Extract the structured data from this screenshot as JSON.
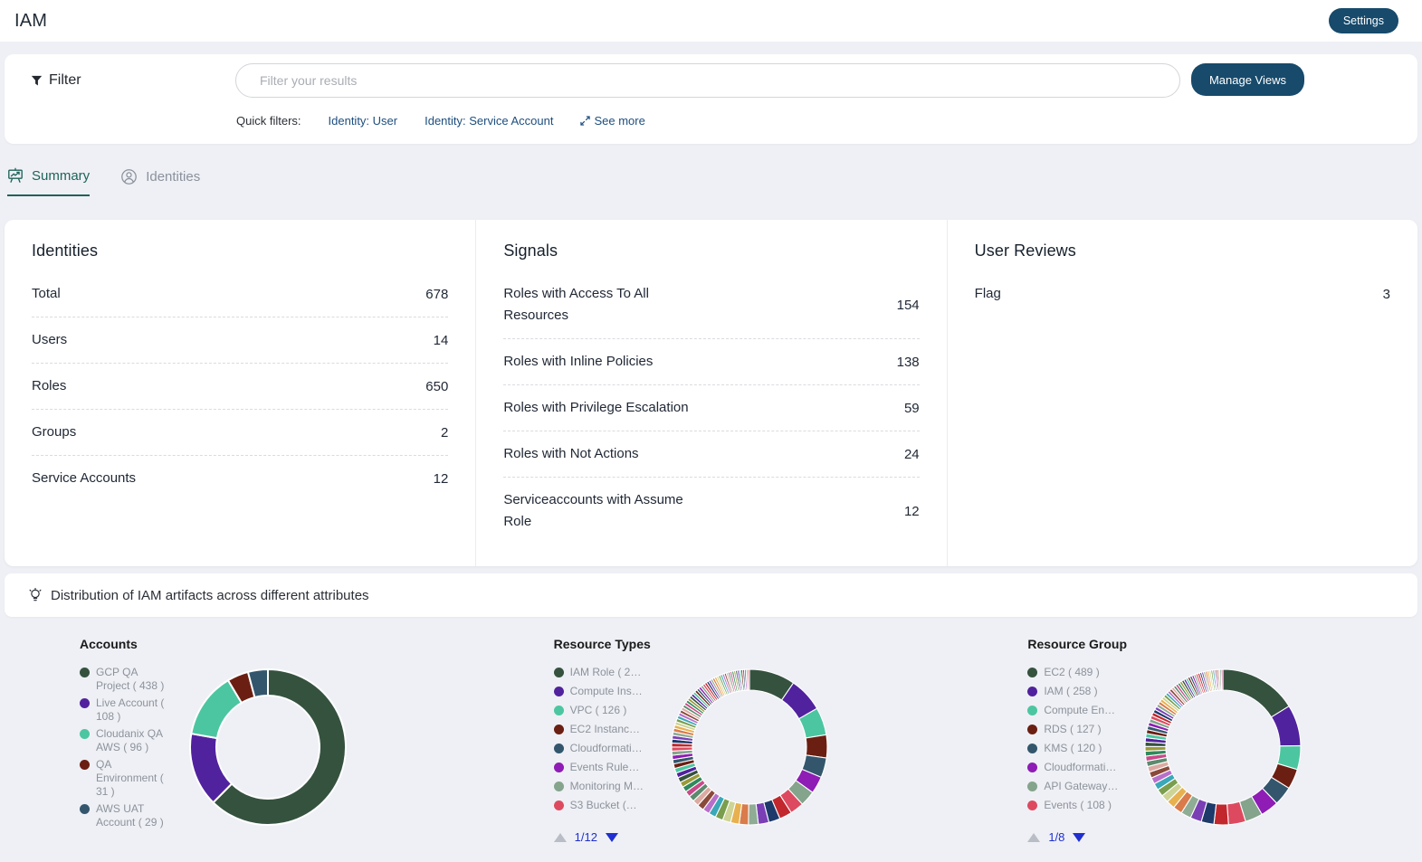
{
  "topbar": {
    "title": "IAM",
    "settings_label": "Settings"
  },
  "filter": {
    "label": "Filter",
    "input_value": "",
    "input_placeholder": "Filter your results",
    "manage_views_label": "Manage Views",
    "quick": {
      "label": "Quick filters:",
      "links": [
        "Identity: User",
        "Identity: Service Account"
      ],
      "see_more": "See more"
    }
  },
  "tabs": [
    {
      "label": "Summary",
      "active": true,
      "icon": "presentation-chart-icon"
    },
    {
      "label": "Identities",
      "active": false,
      "icon": "person-circle-icon"
    }
  ],
  "cards": [
    {
      "title": "Identities",
      "rows": [
        {
          "label": "Total",
          "value": "678"
        },
        {
          "label": "Users",
          "value": "14"
        },
        {
          "label": "Roles",
          "value": "650"
        },
        {
          "label": "Groups",
          "value": "2"
        },
        {
          "label": "Service Accounts",
          "value": "12"
        }
      ]
    },
    {
      "title": "Signals",
      "rows": [
        {
          "label": "Roles with Access To All Resources",
          "value": "154"
        },
        {
          "label": "Roles with Inline Policies",
          "value": "138"
        },
        {
          "label": "Roles with Privilege Escalation",
          "value": "59"
        },
        {
          "label": "Roles with Not Actions",
          "value": "24"
        },
        {
          "label": "Serviceaccounts with Assume Role",
          "value": "12"
        }
      ]
    },
    {
      "title": "User Reviews",
      "rows": [
        {
          "label": "Flag",
          "value": "3"
        }
      ]
    }
  ],
  "distribution": {
    "header": "Distribution of IAM artifacts across different attributes"
  },
  "colors": {
    "accent_navy": "#174a6b",
    "link_blue": "#1d4e7e",
    "tab_active": "#1e635a",
    "pager_blue": "#1f2fd0",
    "page_bg": "#eef0f5"
  },
  "chart_data": [
    {
      "type": "donut",
      "title": "Accounts",
      "legend": [
        {
          "label": "GCP QA Project ( 438 )",
          "color": "#35523f"
        },
        {
          "label": "Live Account ( 108 )",
          "color": "#51229e"
        },
        {
          "label": "Cloudanix QA AWS ( 96 )",
          "color": "#4cc6a0"
        },
        {
          "label": "QA Environment ( 31 )",
          "color": "#6b1f12"
        },
        {
          "label": "AWS UAT Account ( 29 )",
          "color": "#33566d"
        }
      ],
      "values": [
        438,
        108,
        96,
        31,
        29
      ],
      "palette": [
        "#35523f",
        "#51229e",
        "#4cc6a0",
        "#6b1f12",
        "#33566d"
      ],
      "outer_radius": 86,
      "inner_radius": 57,
      "pagination": null
    },
    {
      "type": "donut",
      "title": "Resource Types",
      "legend": [
        {
          "label": "IAM Role ( 2…",
          "color": "#35523f"
        },
        {
          "label": "Compute Ins…",
          "color": "#51229e"
        },
        {
          "label": "VPC ( 126 )",
          "color": "#4cc6a0"
        },
        {
          "label": "EC2 Instanc…",
          "color": "#6b1f12"
        },
        {
          "label": "Cloudformati…",
          "color": "#33566d"
        },
        {
          "label": "Events Rule…",
          "color": "#8e1cb5"
        },
        {
          "label": "Monitoring M…",
          "color": "#84a48c"
        },
        {
          "label": "S3 Bucket (…",
          "color": "#dd4a60"
        }
      ],
      "values": [
        333,
        250,
        200,
        167,
        143,
        125,
        111,
        100,
        91,
        83,
        77,
        71,
        67,
        62,
        59,
        56,
        53,
        50,
        48,
        45,
        43,
        42,
        40,
        38,
        37,
        36,
        34,
        33,
        32,
        31,
        30,
        29,
        29,
        28,
        27,
        26,
        26,
        25,
        24,
        24,
        23,
        23,
        22,
        22,
        21,
        21,
        20,
        20,
        20,
        19,
        19,
        19,
        18,
        18,
        18,
        17,
        17,
        17,
        16,
        16,
        16,
        16,
        15,
        15,
        15,
        15,
        14,
        14,
        14,
        14,
        14,
        13,
        13,
        13,
        13,
        13,
        13,
        12,
        12,
        12
      ],
      "palette": [
        "#35523f",
        "#51229e",
        "#4cc6a0",
        "#6b1f12",
        "#33566d",
        "#8e1cb5",
        "#84a48c",
        "#dd4a60",
        "#c1272d",
        "#1d3a6b",
        "#7a3fb5",
        "#8fac94",
        "#d97b4a",
        "#e8b14f",
        "#cdd495",
        "#7a9e4e",
        "#3aa8b8",
        "#b86fc9",
        "#8a4a3a",
        "#dcaaa2",
        "#5c8a6e",
        "#c94a8a",
        "#2f8a5c",
        "#9a9a3a"
      ],
      "outer_radius": 86,
      "inner_radius": 63,
      "pagination": {
        "current": "1/12"
      }
    },
    {
      "type": "donut",
      "title": "Resource Group",
      "legend": [
        {
          "label": "EC2 ( 489 )",
          "color": "#35523f"
        },
        {
          "label": "IAM ( 258 )",
          "color": "#51229e"
        },
        {
          "label": "Compute En…",
          "color": "#4cc6a0"
        },
        {
          "label": "RDS ( 127 )",
          "color": "#6b1f12"
        },
        {
          "label": "KMS ( 120 )",
          "color": "#33566d"
        },
        {
          "label": "Cloudformati…",
          "color": "#8e1cb5"
        },
        {
          "label": "API Gateway…",
          "color": "#84a48c"
        },
        {
          "label": "Events ( 108 )",
          "color": "#dd4a60"
        }
      ],
      "values": [
        489,
        258,
        150,
        127,
        120,
        115,
        110,
        108,
        91,
        80,
        71,
        64,
        58,
        53,
        49,
        46,
        43,
        40,
        38,
        36,
        34,
        32,
        31,
        29,
        28,
        27,
        26,
        25,
        24,
        23,
        23,
        22,
        21,
        21,
        20,
        20,
        19,
        19,
        18,
        18,
        17,
        17,
        17,
        16,
        16,
        16,
        15,
        15,
        15,
        14,
        14,
        14,
        14,
        13,
        13,
        13,
        13,
        12,
        12,
        12,
        12,
        12,
        11,
        11,
        11,
        11,
        11,
        11,
        10,
        10
      ],
      "palette": [
        "#35523f",
        "#51229e",
        "#4cc6a0",
        "#6b1f12",
        "#33566d",
        "#8e1cb5",
        "#84a48c",
        "#dd4a60",
        "#c1272d",
        "#1d3a6b",
        "#7a3fb5",
        "#8fac94",
        "#d97b4a",
        "#e8b14f",
        "#cdd495",
        "#7a9e4e",
        "#3aa8b8",
        "#b86fc9",
        "#8a4a3a",
        "#dcaaa2",
        "#5c8a6e",
        "#c94a8a",
        "#2f8a5c",
        "#9a9a3a"
      ],
      "outer_radius": 86,
      "inner_radius": 63,
      "pagination": {
        "current": "1/8"
      }
    }
  ]
}
